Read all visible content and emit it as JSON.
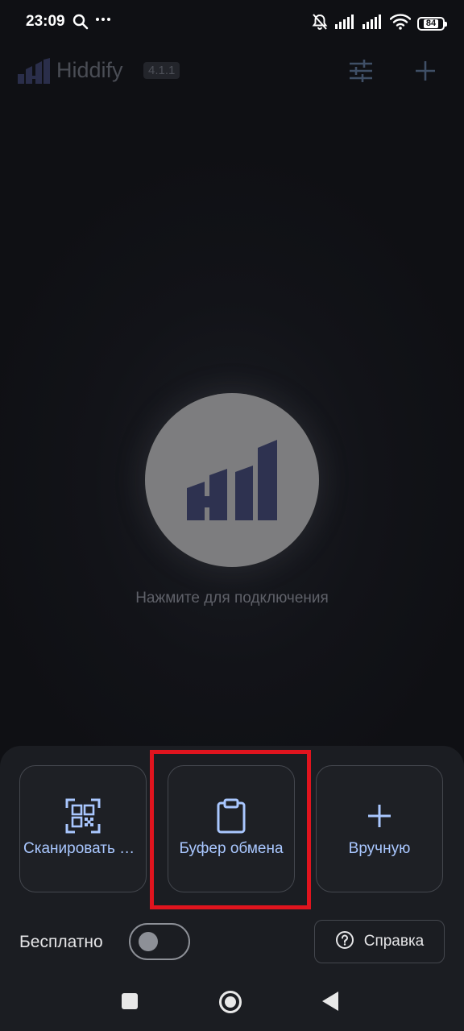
{
  "status_bar": {
    "time": "23:09",
    "battery_level": "84",
    "icons": [
      "search-icon",
      "more-dots-icon",
      "bell-off-icon",
      "signal-icon",
      "signal-icon",
      "wifi-icon",
      "battery-icon"
    ]
  },
  "header": {
    "title": "Hiddify",
    "version": "4.1.1"
  },
  "main": {
    "connect_hint": "Нажмите для подключения"
  },
  "sheet": {
    "options": [
      {
        "label": "Сканировать QR-код",
        "icon": "qr-scan-icon"
      },
      {
        "label": "Буфер обмена",
        "icon": "clipboard-icon"
      },
      {
        "label": "Вручную",
        "icon": "plus-icon"
      }
    ],
    "free_label": "Бесплатно",
    "free_toggle_on": false,
    "help_label": "Справка"
  },
  "colors": {
    "accent": "#a9c7ff",
    "logo": "#2f3352",
    "highlight": "#e0141e"
  }
}
